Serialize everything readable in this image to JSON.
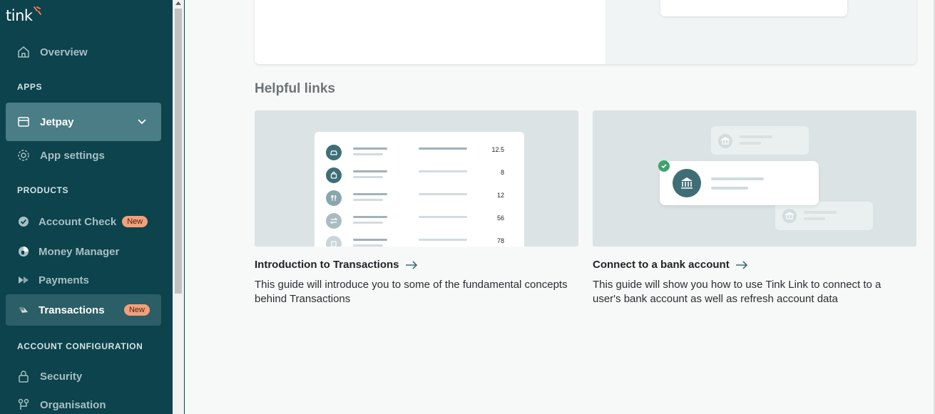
{
  "brand": {
    "logo_text": "tink",
    "accent": "#f2774a"
  },
  "sidebar": {
    "overview": "Overview",
    "apps_label": "APPS",
    "app_selector": "Jetpay",
    "app_settings": "App settings",
    "products_label": "PRODUCTS",
    "products": [
      {
        "label": "Account Check",
        "badge": "New"
      },
      {
        "label": "Money Manager",
        "badge": ""
      },
      {
        "label": "Payments",
        "badge": ""
      },
      {
        "label": "Transactions",
        "badge": "New"
      }
    ],
    "account_config_label": "ACCOUNT CONFIGURATION",
    "security": "Security",
    "organisation": "Organisation"
  },
  "main": {
    "helpful_links_title": "Helpful links",
    "cards": [
      {
        "title": "Introduction to Transactions",
        "description": "This guide will introduce you to some of the fundamental concepts behind Transactions",
        "values": [
          "12.5",
          "8",
          "12",
          "56",
          "78"
        ]
      },
      {
        "title": "Connect to a bank account",
        "description": "This guide will show you how to use Tink Link to connect to a user's bank account as well as refresh account data"
      }
    ]
  }
}
